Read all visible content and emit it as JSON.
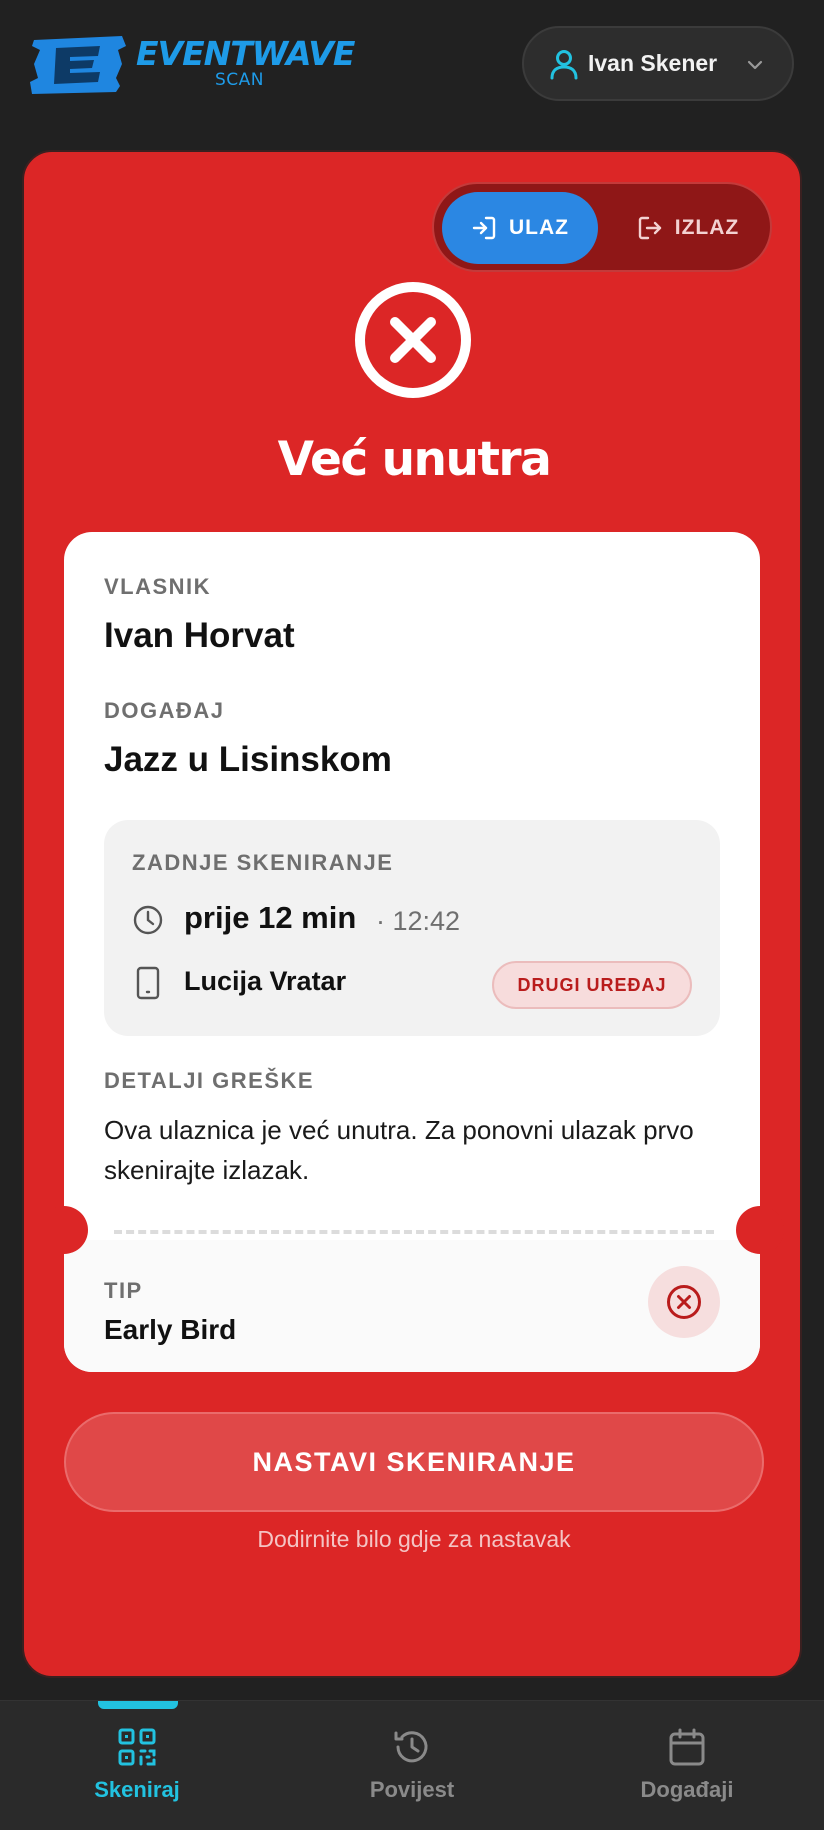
{
  "header": {
    "logo_text": "EVENTWAVE",
    "logo_sub": "SCAN",
    "user_name": "Ivan Skener"
  },
  "mode_toggle": {
    "entry_label": "ULAZ",
    "exit_label": "IZLAZ",
    "selected": "ULAZ"
  },
  "status": {
    "title": "Već unutra",
    "color": "#dc2626"
  },
  "ticket": {
    "owner_label": "VLASNIK",
    "owner_value": "Ivan Horvat",
    "event_label": "DOGAĐAJ",
    "event_value": "Jazz u Lisinskom",
    "last_scan": {
      "label": "ZADNJE SKENIRANJE",
      "ago": "prije 12 min",
      "time": "· 12:42",
      "device": "Lucija Vratar",
      "badge": "DRUGI UREĐAJ"
    },
    "error_label": "DETALJI GREŠKE",
    "error_text": "Ova ulaznica je već unutra. Za ponovni ulazak prvo skenirajte izlazak.",
    "type_label": "TIP",
    "type_value": "Early Bird"
  },
  "actions": {
    "continue_label": "NASTAVI SKENIRANJE",
    "hint": "Dodirnite bilo gdje za nastavak"
  },
  "bottom_nav": {
    "items": [
      {
        "label": "Skeniraj",
        "icon": "qr-code-icon",
        "active": true
      },
      {
        "label": "Povijest",
        "icon": "history-icon",
        "active": false
      },
      {
        "label": "Događaji",
        "icon": "calendar-icon",
        "active": false
      }
    ]
  },
  "colors": {
    "accent_cyan": "#22c2e0",
    "brand_blue": "#1e9be8",
    "error_red": "#dc2626"
  }
}
